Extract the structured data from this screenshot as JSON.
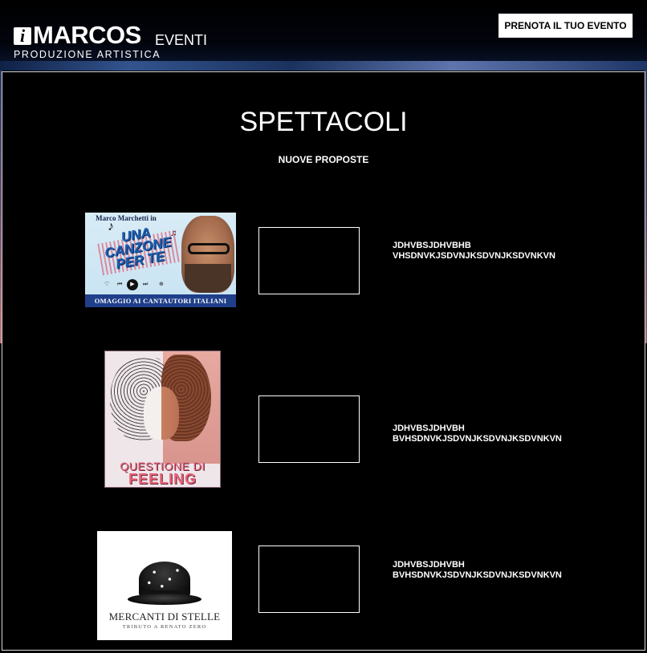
{
  "header": {
    "logo_icon": "i",
    "logo_main": "MARCOS",
    "logo_suffix": "EVENTI",
    "logo_tagline": "PRODUZIONE ARTISTICA",
    "cta_label": "PRENOTA IL TUO EVENTO"
  },
  "main": {
    "title": "SPETTACOLI",
    "subtitle": "NUOVE PROPOSTE"
  },
  "shows": [
    {
      "poster_credit": "Marco Marchetti in",
      "poster_title": "UNA CANZONE PER TE",
      "poster_bar": "OMAGGIO AI CANTAUTORI ITALIANI",
      "text_line1": "JDHVBSJDHVBHB",
      "text_line2": "VHSDNVKJSDVNJKSDVNJKSDVNKVN"
    },
    {
      "poster_title1": "QUESTIONE DI",
      "poster_title2": "FEELING",
      "text_line1": "JDHVBSJDHVBH",
      "text_line2": "BVHSDNVKJSDVNJKSDVNJKSDVNKVN"
    },
    {
      "poster_title": "MERCANTI DI STELLE",
      "poster_sub": "TRIBUTO A RENATO ZERO",
      "text_line1": "JDHVBSJDHVBH",
      "text_line2": "BVHSDNVKJSDVNJKSDVNJKSDVNKVN"
    }
  ],
  "colors": {
    "background": "#000000",
    "cta_bg": "#ffffff",
    "accent_blue": "#1f3f8a",
    "accent_pink": "#e8647a"
  }
}
